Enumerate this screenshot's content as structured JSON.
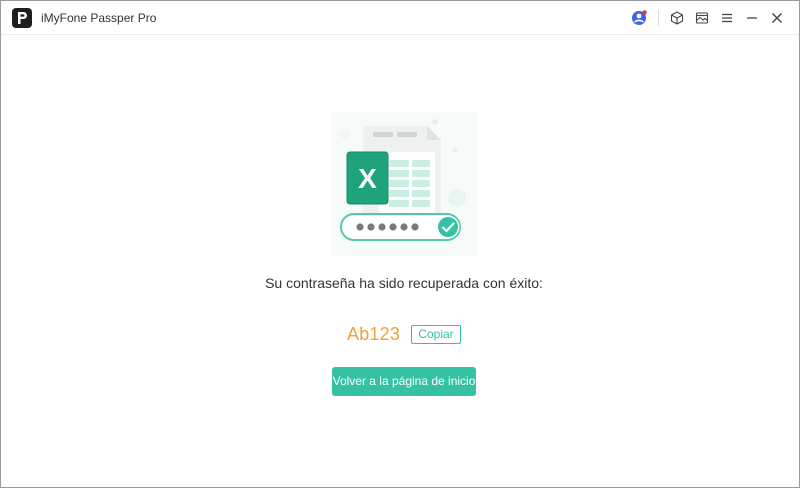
{
  "window": {
    "title": "iMyFone Passper Pro",
    "icons": [
      "app-logo-icon",
      "account-icon",
      "cube-icon",
      "image-icon",
      "menu-icon",
      "minimize-icon",
      "close-icon"
    ]
  },
  "result": {
    "message": "Su contraseña ha sido recuperada con éxito:",
    "password": "Ab123",
    "copy_label": "Copiar",
    "home_button_label": "Volver a la página de inicio"
  },
  "hero": {
    "icon": "excel-unlocked-illustration",
    "excel_letter": "X"
  },
  "colors": {
    "accent": "#35c2a3",
    "password": "#f5a037",
    "excel_green": "#1fa37d",
    "notification_dot": "#e53935",
    "account_blue": "#3d63ea"
  }
}
